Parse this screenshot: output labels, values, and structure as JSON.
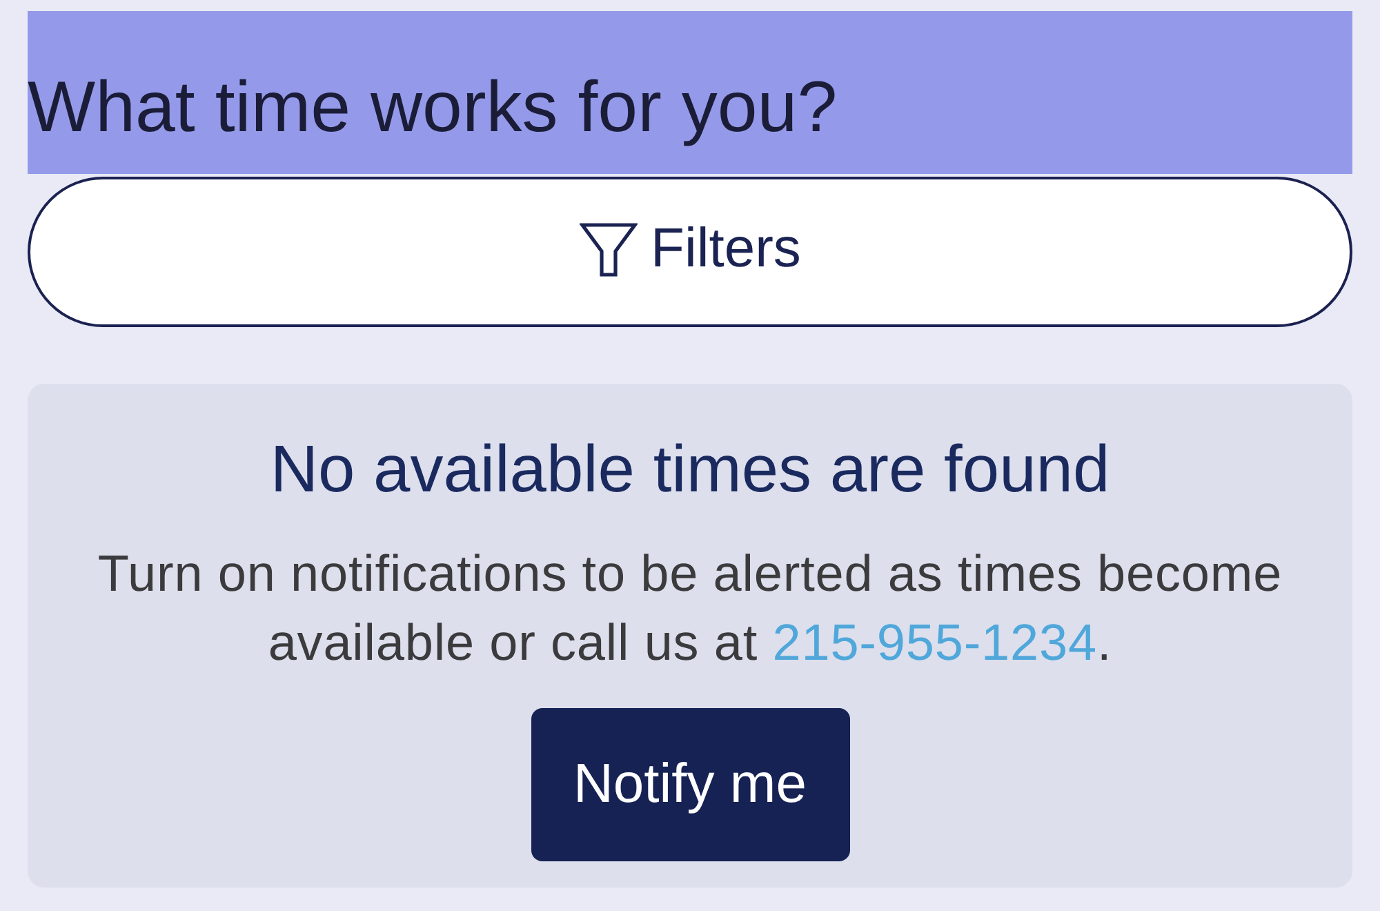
{
  "header": {
    "title": "What time works for you?"
  },
  "filters_button": {
    "label": "Filters"
  },
  "empty_state": {
    "title": "No available times are found",
    "message": "Turn on notifications to be alerted as times become available or call us at ",
    "phone_link": "215-955-1234",
    "message_end": ".",
    "button": "Notify me"
  }
}
